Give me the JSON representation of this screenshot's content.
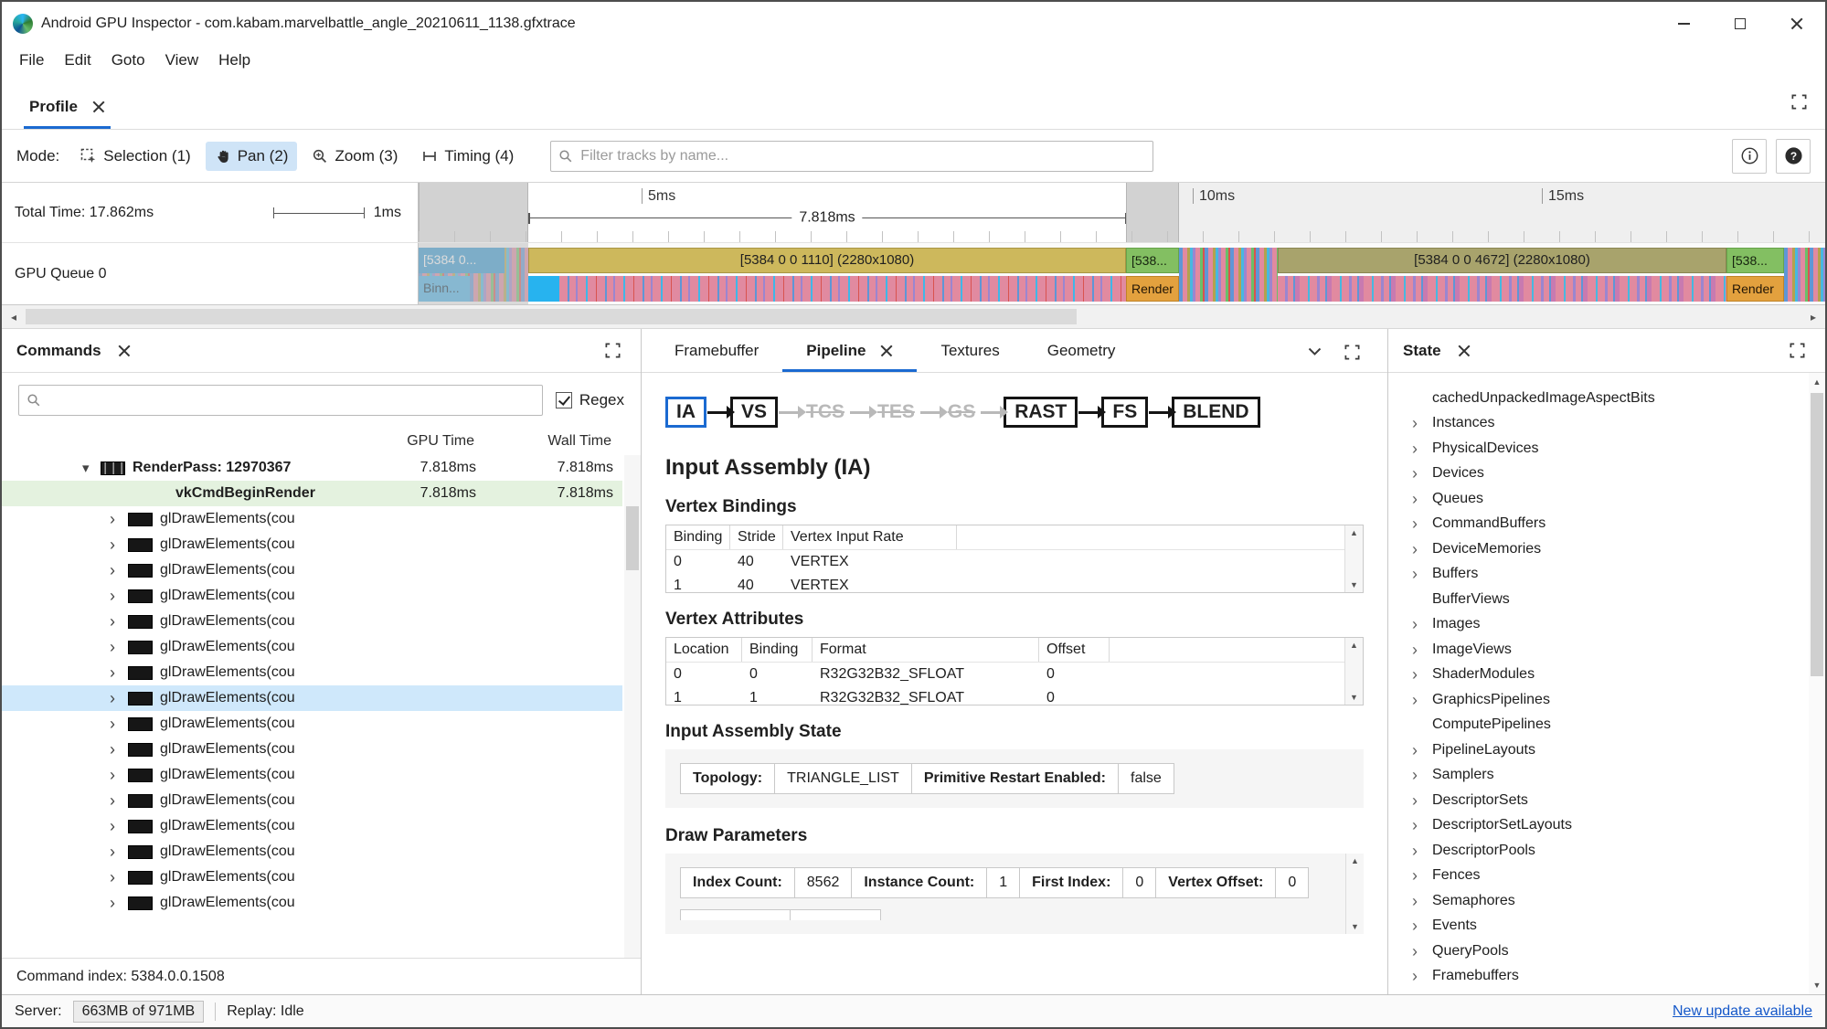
{
  "icons": {
    "caret_expanded": "▾",
    "caret_collapsed": "›",
    "chevron_right": "›",
    "scroll_up": "▲",
    "scroll_down": "▼",
    "scroll_left": "◂",
    "scroll_right": "▸"
  },
  "colors": {
    "accent_blue": "#1b6ad1",
    "selection_blue": "#cfe8fb",
    "highlight_green": "#e4f2df",
    "pan_active_bg": "#cfe4f7",
    "bar_gold": "#cdb85c",
    "bar_olive": "#a8a36c",
    "bar_green": "#83bf62",
    "bar_orange": "#e3a13e",
    "bar_blue": "#2f9ad6",
    "link_blue": "#1558c9"
  },
  "window": {
    "title": "Android GPU Inspector - com.kabam.marvelbattle_angle_20210611_1138.gfxtrace"
  },
  "menu": {
    "items": [
      "File",
      "Edit",
      "Goto",
      "View",
      "Help"
    ]
  },
  "tabs": {
    "profile": "Profile"
  },
  "toolbar": {
    "mode_label": "Mode:",
    "modes": [
      {
        "label": "Selection (1)",
        "icon": "selection",
        "active": false
      },
      {
        "label": "Pan (2)",
        "icon": "pan",
        "active": true
      },
      {
        "label": "Zoom (3)",
        "icon": "zoom",
        "active": false
      },
      {
        "label": "Timing (4)",
        "icon": "timing",
        "active": false
      }
    ],
    "filter_placeholder": "Filter tracks by name..."
  },
  "timeline": {
    "total_time_label": "Total Time: 17.862ms",
    "scale_label": "1ms",
    "ruler_marks": [
      "5ms",
      "10ms",
      "15ms"
    ],
    "measurement": "7.818ms",
    "track_label": "GPU Queue 0",
    "segments": [
      {
        "top": "[5384 0...",
        "bottom": "Binn..."
      },
      {
        "top": "[5384 0 0 1110] (2280x1080)",
        "bottom": ""
      },
      {
        "top": "[538...",
        "bottom": "Render"
      },
      {
        "top": "[5384 0 0 4672] (2280x1080)",
        "bottom": ""
      },
      {
        "top": "[538...",
        "bottom": "Render"
      }
    ]
  },
  "commands": {
    "title": "Commands",
    "regex_label": "Regex",
    "columns": [
      "GPU Time",
      "Wall Time"
    ],
    "status": "Command index: 5384.0.0.1508",
    "rows": [
      {
        "kind": "renderpass",
        "label": "RenderPass: 12970367",
        "gpu": "7.818ms",
        "wall": "7.818ms",
        "bold": true
      },
      {
        "kind": "call",
        "label": "vkCmdBeginRender",
        "gpu": "7.818ms",
        "wall": "7.818ms",
        "bold": true,
        "highlight": "green"
      },
      {
        "kind": "draw",
        "label": "glDrawElements(cou",
        "selected": false
      },
      {
        "kind": "draw",
        "label": "glDrawElements(cou",
        "selected": false
      },
      {
        "kind": "draw",
        "label": "glDrawElements(cou",
        "selected": false
      },
      {
        "kind": "draw",
        "label": "glDrawElements(cou",
        "selected": false
      },
      {
        "kind": "draw",
        "label": "glDrawElements(cou",
        "selected": false
      },
      {
        "kind": "draw",
        "label": "glDrawElements(cou",
        "selected": false
      },
      {
        "kind": "draw",
        "label": "glDrawElements(cou",
        "selected": false
      },
      {
        "kind": "draw",
        "label": "glDrawElements(cou",
        "selected": true
      },
      {
        "kind": "draw",
        "label": "glDrawElements(cou",
        "selected": false
      },
      {
        "kind": "draw",
        "label": "glDrawElements(cou",
        "selected": false
      },
      {
        "kind": "draw",
        "label": "glDrawElements(cou",
        "selected": false
      },
      {
        "kind": "draw",
        "label": "glDrawElements(cou",
        "selected": false
      },
      {
        "kind": "draw",
        "label": "glDrawElements(cou",
        "selected": false
      },
      {
        "kind": "draw",
        "label": "glDrawElements(cou",
        "selected": false
      },
      {
        "kind": "draw",
        "label": "glDrawElements(cou",
        "selected": false
      },
      {
        "kind": "draw",
        "label": "glDrawElements(cou",
        "selected": false
      }
    ]
  },
  "pipeline_panel": {
    "tabs": [
      "Framebuffer",
      "Pipeline",
      "Textures",
      "Geometry"
    ],
    "active_tab": "Pipeline",
    "stages": [
      {
        "label": "IA",
        "style": "active"
      },
      {
        "label": "VS",
        "style": "normal"
      },
      {
        "label": "TCS",
        "style": "dim"
      },
      {
        "label": "TES",
        "style": "dim"
      },
      {
        "label": "GS",
        "style": "dim"
      },
      {
        "label": "RAST",
        "style": "normal"
      },
      {
        "label": "FS",
        "style": "normal"
      },
      {
        "label": "BLEND",
        "style": "normal"
      }
    ],
    "section_title": "Input Assembly (IA)",
    "vertex_bindings": {
      "title": "Vertex Bindings",
      "columns": [
        "Binding",
        "Stride",
        "Vertex Input Rate"
      ],
      "rows": [
        [
          "0",
          "40",
          "VERTEX"
        ],
        [
          "1",
          "40",
          "VERTEX"
        ]
      ]
    },
    "vertex_attributes": {
      "title": "Vertex Attributes",
      "columns": [
        "Location",
        "Binding",
        "Format",
        "Offset"
      ],
      "rows": [
        [
          "0",
          "0",
          "R32G32B32_SFLOAT",
          "0"
        ],
        [
          "1",
          "1",
          "R32G32B32_SFLOAT",
          "0"
        ]
      ]
    },
    "input_assembly_state": {
      "title": "Input Assembly State",
      "fields": [
        {
          "label": "Topology:",
          "value": "TRIANGLE_LIST"
        },
        {
          "label": "Primitive Restart Enabled:",
          "value": "false"
        }
      ]
    },
    "draw_parameters": {
      "title": "Draw Parameters",
      "fields": [
        {
          "label": "Index Count:",
          "value": "8562"
        },
        {
          "label": "Instance Count:",
          "value": "1"
        },
        {
          "label": "First Index:",
          "value": "0"
        },
        {
          "label": "Vertex Offset:",
          "value": "0"
        }
      ]
    }
  },
  "state_panel": {
    "title": "State",
    "items": [
      {
        "label": "cachedUnpackedImageAspectBits",
        "chevron": false
      },
      {
        "label": "Instances",
        "chevron": true
      },
      {
        "label": "PhysicalDevices",
        "chevron": true
      },
      {
        "label": "Devices",
        "chevron": true
      },
      {
        "label": "Queues",
        "chevron": true
      },
      {
        "label": "CommandBuffers",
        "chevron": true
      },
      {
        "label": "DeviceMemories",
        "chevron": true
      },
      {
        "label": "Buffers",
        "chevron": true
      },
      {
        "label": "BufferViews",
        "chevron": false
      },
      {
        "label": "Images",
        "chevron": true
      },
      {
        "label": "ImageViews",
        "chevron": true
      },
      {
        "label": "ShaderModules",
        "chevron": true
      },
      {
        "label": "GraphicsPipelines",
        "chevron": true
      },
      {
        "label": "ComputePipelines",
        "chevron": false
      },
      {
        "label": "PipelineLayouts",
        "chevron": true
      },
      {
        "label": "Samplers",
        "chevron": true
      },
      {
        "label": "DescriptorSets",
        "chevron": true
      },
      {
        "label": "DescriptorSetLayouts",
        "chevron": true
      },
      {
        "label": "DescriptorPools",
        "chevron": true
      },
      {
        "label": "Fences",
        "chevron": true
      },
      {
        "label": "Semaphores",
        "chevron": true
      },
      {
        "label": "Events",
        "chevron": true
      },
      {
        "label": "QueryPools",
        "chevron": true
      },
      {
        "label": "Framebuffers",
        "chevron": true
      }
    ]
  },
  "statusbar": {
    "server_label": "Server:",
    "server_value": "663MB of 971MB",
    "replay": "Replay: Idle",
    "update_link": "New update available"
  }
}
